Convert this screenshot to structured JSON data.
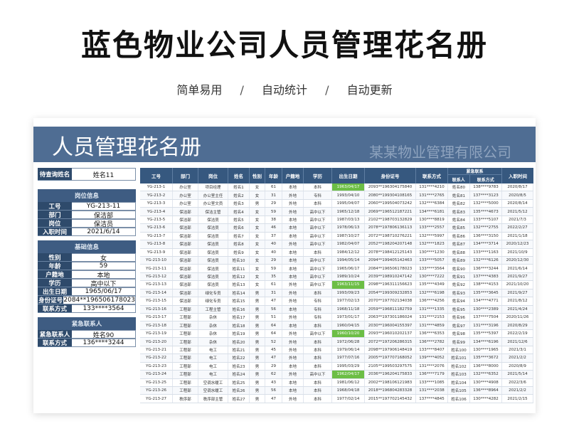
{
  "header": {
    "title": "蓝色物业公司人员管理花名册",
    "features": [
      "简单易用",
      "自动统计",
      "自动更新"
    ],
    "separator": "/"
  },
  "banner": {
    "title": "人员管理花名册",
    "company": "某某物业管理有限公司"
  },
  "query": {
    "label": "待查询姓名",
    "value": "姓名11"
  },
  "post_section": {
    "title": "岗位信息",
    "fields": [
      {
        "label": "工号",
        "value": "YG-213-11"
      },
      {
        "label": "部门",
        "value": "保洁部"
      },
      {
        "label": "岗位",
        "value": "保洁员"
      },
      {
        "label": "入职时间",
        "value": "2021/6/14"
      }
    ]
  },
  "basic_section": {
    "title": "基础信息",
    "fields": [
      {
        "label": "性别",
        "value": "女"
      },
      {
        "label": "年龄",
        "value": "59"
      },
      {
        "label": "户籍地",
        "value": "本地"
      },
      {
        "label": "学历",
        "value": "高中以下"
      },
      {
        "label": "出生日期",
        "value": "1965/06/17"
      },
      {
        "label": "身份证号",
        "value": "2084**196506178023"
      },
      {
        "label": "联系方式",
        "value": "133****3564"
      }
    ]
  },
  "emergency_section": {
    "title": "紧急联系人",
    "fields": [
      {
        "label": "紧急联系人",
        "value": "姓名90"
      },
      {
        "label": "联系方式",
        "value": "136****3244"
      }
    ]
  },
  "table": {
    "columns": [
      "工号",
      "部门",
      "岗位",
      "姓名",
      "性别",
      "年龄",
      "户籍地",
      "学历",
      "出生日期",
      "身份证号",
      "联系方式"
    ],
    "emergency_group": "紧急联系",
    "emergency_columns": [
      "联系人",
      "联系方式"
    ],
    "last_column": "入职时间",
    "rows": [
      [
        "YG-213-1",
        "办公室",
        "项目经理",
        "姓名1",
        "女",
        "61",
        "本地",
        "本科",
        "1963/04/17",
        "2093**196304175840",
        "131****4210",
        "姓名80",
        "138****9783",
        "2020/8/17"
      ],
      [
        "YG-213-2",
        "办公室",
        "办公室主任",
        "姓名2",
        "女",
        "31",
        "外地",
        "专科",
        "1993/04/10",
        "2080**199304108165",
        "131****2765",
        "姓名81",
        "137****3123",
        "2020/8/5"
      ],
      [
        "YG-213-3",
        "办公室",
        "办公室文员",
        "姓名3",
        "男",
        "29",
        "外地",
        "本科",
        "1995/04/07",
        "2060**199504073242",
        "132****6384",
        "姓名82",
        "132****5000",
        "2020/8/14"
      ],
      [
        "YG-213-4",
        "保洁部",
        "保洁主管",
        "姓名4",
        "女",
        "59",
        "外地",
        "高中以下",
        "1965/12/18",
        "2069**196512187221",
        "134****6181",
        "姓名83",
        "135****4673",
        "2021/5/12"
      ],
      [
        "YG-213-5",
        "保洁部",
        "保洁员",
        "姓名5",
        "女",
        "38",
        "本地",
        "高中以下",
        "1987/03/13",
        "2102**198703132829",
        "130****8819",
        "姓名84",
        "133****5107",
        "2021/7/3"
      ],
      [
        "YG-213-6",
        "保洁部",
        "保洁员",
        "姓名6",
        "女",
        "46",
        "本地",
        "高中以下",
        "1978/06/13",
        "2078**197806136113",
        "133****2557",
        "姓名85",
        "132****2755",
        "2022/2/27"
      ],
      [
        "YG-213-7",
        "保洁部",
        "保洁员",
        "姓名7",
        "女",
        "37",
        "本地",
        "高中以下",
        "1987/10/27",
        "2072**198710276221",
        "132****5997",
        "姓名86",
        "136****3150",
        "2021/1/18"
      ],
      [
        "YG-213-8",
        "保洁部",
        "保洁员",
        "姓名8",
        "女",
        "40",
        "外地",
        "高中以下",
        "1982/04/07",
        "2052**198204207148",
        "132****1823",
        "姓名87",
        "134****3714",
        "2020/12/23"
      ],
      [
        "YG-213-9",
        "保洁部",
        "保洁员",
        "姓名9",
        "女",
        "40",
        "本地",
        "本科",
        "1984/12/12",
        "2078**198412125143",
        "130****1230",
        "姓名88",
        "133****1163",
        "2021/10/9"
      ],
      [
        "YG-213-10",
        "保洁部",
        "保洁员",
        "姓名10",
        "女",
        "29",
        "本地",
        "高中以下",
        "1994/05/14",
        "2094**199405142463",
        "133****5057",
        "姓名89",
        "132****6126",
        "2020/12/30"
      ],
      [
        "YG-213-11",
        "保洁部",
        "保洁员",
        "姓名11",
        "女",
        "59",
        "本地",
        "高中以下",
        "1965/06/17",
        "2084**196506178023",
        "133****3564",
        "姓名90",
        "136****3244",
        "2021/6/14"
      ],
      [
        "YG-213-12",
        "保洁部",
        "保洁员",
        "姓名12",
        "女",
        "35",
        "本地",
        "高中以下",
        "1989/10/24",
        "2039**198910247142",
        "130****7222",
        "姓名91",
        "137****4383",
        "2021/9/27"
      ],
      [
        "YG-213-13",
        "保洁部",
        "保洁员",
        "姓名13",
        "女",
        "61",
        "外地",
        "高中以下",
        "1963/11/15",
        "2098**196311156623",
        "135****4349",
        "姓名92",
        "138****4153",
        "2021/10/20"
      ],
      [
        "YG-213-14",
        "保洁部",
        "绿化专员",
        "姓名14",
        "男",
        "31",
        "外地",
        "本科",
        "1993/09/23",
        "2054**199309232853",
        "132****6198",
        "姓名93",
        "135****3645",
        "2021/9/27"
      ],
      [
        "YG-213-15",
        "保洁部",
        "绿化专员",
        "姓名15",
        "男",
        "47",
        "外地",
        "专科",
        "1977/02/13",
        "2070**197702134038",
        "136****4256",
        "姓名94",
        "134****4771",
        "2021/8/12"
      ],
      [
        "YG-213-16",
        "工程部",
        "工程主管",
        "姓名16",
        "男",
        "56",
        "本地",
        "专科",
        "1968/11/18",
        "2059**196811182759",
        "131****1335",
        "姓名95",
        "130****2389",
        "2021/4/24"
      ],
      [
        "YG-213-17",
        "工程部",
        "杂休",
        "姓名17",
        "男",
        "51",
        "外地",
        "专科",
        "1973/01/17",
        "2063**197301186024",
        "131****2153",
        "姓名96",
        "137****7504",
        "2020/11/26"
      ],
      [
        "YG-213-18",
        "工程部",
        "杂休",
        "姓名18",
        "男",
        "64",
        "本地",
        "本科",
        "1960/04/15",
        "2030**196004155397",
        "131****4859",
        "姓名97",
        "131****3196",
        "2020/8/29"
      ],
      [
        "YG-213-19",
        "工程部",
        "杂休",
        "姓名19",
        "男",
        "64",
        "外地",
        "高中以下",
        "1960/10/20",
        "2093**196010202137",
        "136****6353",
        "姓名98",
        "135****5397",
        "2022/2/19"
      ],
      [
        "YG-213-20",
        "工程部",
        "杂休",
        "姓名20",
        "男",
        "52",
        "外地",
        "本科",
        "1972/06/28",
        "2072**197206286315",
        "136****2782",
        "姓名99",
        "134****6196",
        "2021/12/6"
      ],
      [
        "YG-213-21",
        "工程部",
        "电工",
        "姓名21",
        "男",
        "45",
        "外地",
        "本科",
        "1979/06/14",
        "2098**197906148419",
        "133****8407",
        "姓名100",
        "130****1965",
        "2021/3/1"
      ],
      [
        "YG-213-22",
        "工程部",
        "电工",
        "姓名22",
        "男",
        "47",
        "外地",
        "本科",
        "1977/07/16",
        "2005**197707168052",
        "139****4052",
        "姓名101",
        "135****3672",
        "2021/2/2"
      ],
      [
        "YG-213-23",
        "工程部",
        "电工",
        "姓名23",
        "男",
        "29",
        "本地",
        "本科",
        "1995/03/29",
        "2105**199503297575",
        "131****2076",
        "姓名102",
        "136****8000",
        "2020/8/9"
      ],
      [
        "YG-213-24",
        "工程部",
        "电工",
        "姓名24",
        "男",
        "62",
        "外地",
        "高中以下",
        "1962/04/17",
        "2036**196204175833",
        "136****7179",
        "姓名103",
        "132****6352",
        "2021/5/14"
      ],
      [
        "YG-213-25",
        "工程部",
        "空调水暖工",
        "姓名25",
        "男",
        "43",
        "本地",
        "本科",
        "1981/06/12",
        "2002**198106121983",
        "133****1085",
        "姓名104",
        "130****4908",
        "2022/3/6"
      ],
      [
        "YG-213-26",
        "工程部",
        "空调水暖工",
        "姓名26",
        "男",
        "56",
        "本地",
        "本科",
        "1968/04/18",
        "2018**196804283328",
        "131****2038",
        "姓名105",
        "136****8964",
        "2021/2/2"
      ],
      [
        "YG-213-27",
        "秩序部",
        "秩序部主管",
        "姓名27",
        "男",
        "47",
        "外地",
        "本科",
        "1977/02/14",
        "2015**197702145432",
        "137****4845",
        "姓名106",
        "130****4282",
        "2021/2/15"
      ]
    ],
    "highlight_color": "#6cbe45",
    "highlight_rows": [
      1,
      13,
      19,
      24
    ]
  },
  "colors": {
    "banner": "#4f6d93",
    "header_dark": "#2e4a6b",
    "accent": "#36587f"
  }
}
